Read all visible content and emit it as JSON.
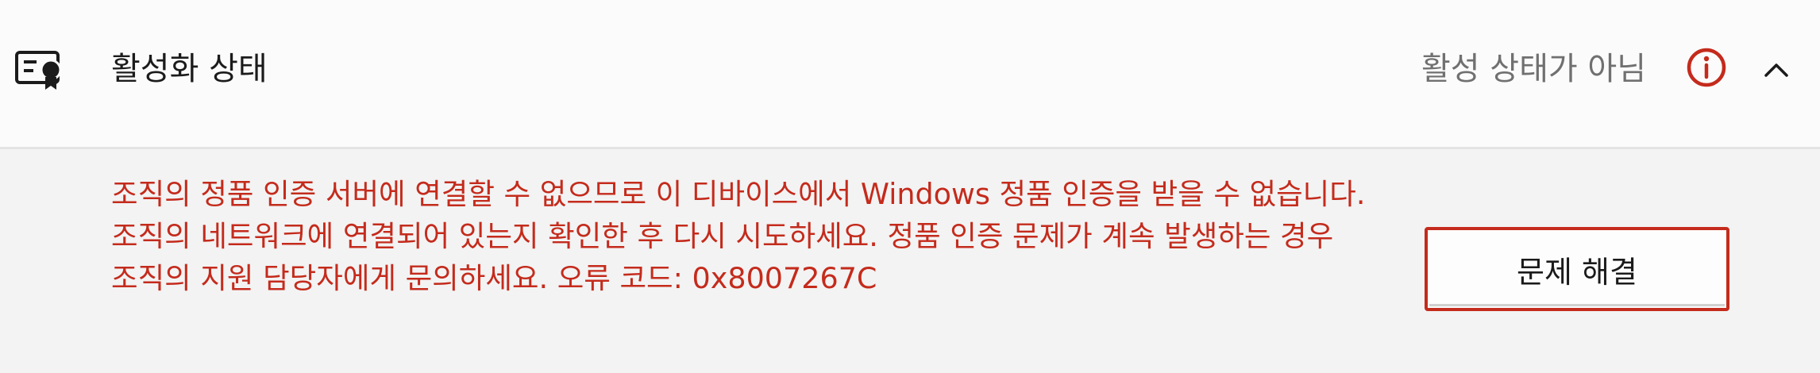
{
  "header": {
    "title": "활성화 상태",
    "status": "활성 상태가 아님",
    "icons": {
      "leading": "certificate-icon",
      "status": "info-icon",
      "toggle": "chevron-up-icon"
    }
  },
  "body": {
    "message": "조직의 정품 인증 서버에 연결할 수 없으므로 이 디바이스에서 Windows 정품 인증을 받을 수 없습니다. 조직의 네트워크에 연결되어 있는지 확인한 후 다시 시도하세요. 정품 인증 문제가 계속 발생하는 경우 조직의 지원 담당자에게 문의하세요. 오류 코드: 0x8007267C",
    "troubleshoot_label": "문제 해결"
  },
  "colors": {
    "error": "#c42b1c",
    "header_background": "#fbfbfb",
    "body_background": "#f3f3f3",
    "muted_text": "#707070"
  }
}
